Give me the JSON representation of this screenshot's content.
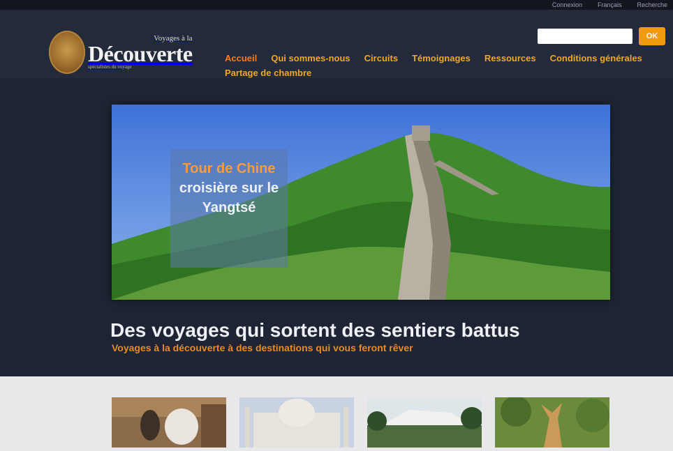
{
  "topbar": {
    "links": [
      "Connexion",
      "Français",
      "Recherche"
    ]
  },
  "logo": {
    "tagline": "Voyages à la",
    "name": "Découverte",
    "subline": "spécialistes du voyage"
  },
  "search": {
    "placeholder": "",
    "button_label": "OK"
  },
  "nav": {
    "items": [
      "Accueil",
      "Qui sommes-nous",
      "Circuits",
      "Témoignages",
      "Ressources",
      "Conditions générales",
      "Partage de chambre"
    ]
  },
  "hero": {
    "caption_accent": "Tour de Chine",
    "caption_rest": "croisière sur le Yangtsé"
  },
  "main": {
    "headline": "Des voyages qui sortent des sentiers battus",
    "subline": "Voyages à la découverte à des destinations qui vous feront rêver"
  },
  "colors": {
    "accent": "#f29a0e",
    "nav_active": "#ff7b16",
    "background": "#1e2433"
  }
}
